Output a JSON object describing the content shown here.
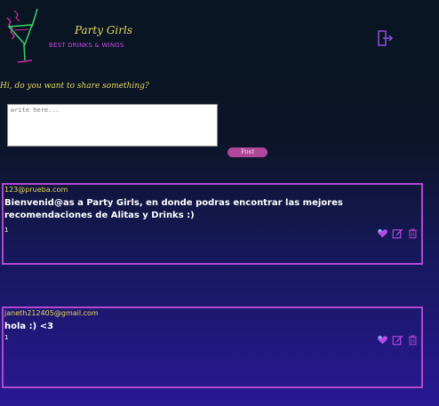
{
  "header": {
    "brand_name": "Party Girls",
    "brand_tagline": "BEST DRINKS & WINGS",
    "logo_icon": "cocktail-glass-neon-logo",
    "logout_icon": "logout-door-icon"
  },
  "composer": {
    "prompt": "Hi, do you want to share something?",
    "placeholder": "write here...",
    "value": "",
    "post_label": "Post"
  },
  "posts": [
    {
      "author": "123@prueba.com",
      "content": "Bienvenid@as a Party Girls, en donde podras encontrar las mejores recomendaciones de Alitas y Drinks :)",
      "likes": "1",
      "actions": [
        "heart-icon",
        "edit-icon",
        "trash-icon"
      ]
    },
    {
      "author": "janeth212405@gmail.com",
      "content": "hola :) <3",
      "likes": "1",
      "actions": [
        "heart-icon",
        "edit-icon",
        "trash-icon"
      ]
    }
  ],
  "colors": {
    "accent_yellow": "#e6d85a",
    "accent_pink": "#b04798",
    "card_border": "#b14acf",
    "icon_heart": "#b64ae8",
    "icon_edit": "#b64ae8",
    "icon_trash": "#a142c4",
    "logo_magenta": "#d12b9a",
    "logo_green": "#3bd46a"
  }
}
